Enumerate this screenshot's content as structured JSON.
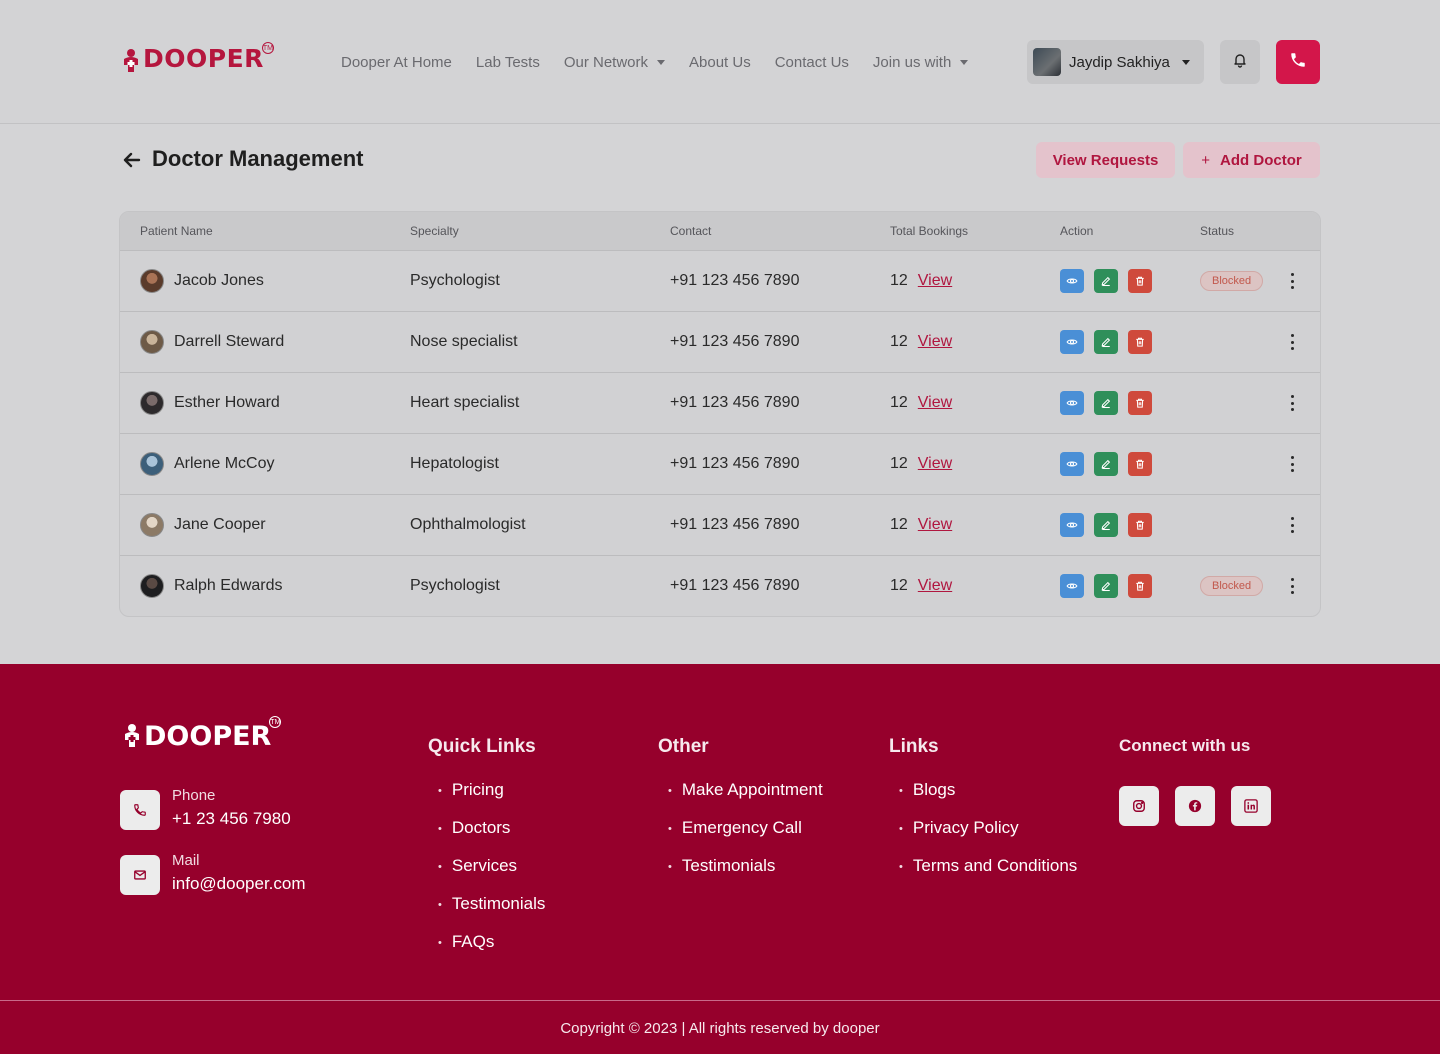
{
  "brand": {
    "name": "DOOPER",
    "tm": "TM",
    "color": "#b5163e"
  },
  "nav": {
    "items": [
      {
        "label": "Dooper At Home",
        "dropdown": false
      },
      {
        "label": "Lab Tests",
        "dropdown": false
      },
      {
        "label": "Our Network",
        "dropdown": true
      },
      {
        "label": "About Us",
        "dropdown": false
      },
      {
        "label": "Contact Us",
        "dropdown": false
      },
      {
        "label": "Join us with",
        "dropdown": true
      }
    ],
    "user_name": "Jaydip Sakhiya",
    "bell_icon": "bell-icon",
    "call_icon": "phone-icon"
  },
  "page": {
    "title": "Doctor Management",
    "view_requests": "View Requests",
    "add_doctor": "Add Doctor",
    "add_doctor_icon": "+"
  },
  "table": {
    "headers": [
      "Patient Name",
      "Specialty",
      "Contact",
      "Total Bookings",
      "Action",
      "Status"
    ],
    "rows": [
      {
        "name": "Jacob Jones",
        "specialty": "Psychologist",
        "contact": "+91 123 456 7890",
        "bookings": "12",
        "view": "View",
        "status": "Blocked"
      },
      {
        "name": "Darrell Steward",
        "specialty": "Nose specialist",
        "contact": "+91 123 456 7890",
        "bookings": "12",
        "view": "View",
        "status": ""
      },
      {
        "name": "Esther Howard",
        "specialty": "Heart specialist",
        "contact": "+91 123 456 7890",
        "bookings": "12",
        "view": "View",
        "status": ""
      },
      {
        "name": "Arlene McCoy",
        "specialty": "Hepatologist",
        "contact": "+91 123 456 7890",
        "bookings": "12",
        "view": "View",
        "status": ""
      },
      {
        "name": "Jane Cooper",
        "specialty": "Ophthalmologist",
        "contact": "+91 123 456 7890",
        "bookings": "12",
        "view": "View",
        "status": ""
      },
      {
        "name": "Ralph Edwards",
        "specialty": "Psychologist",
        "contact": "+91 123 456 7890",
        "bookings": "12",
        "view": "View",
        "status": "Blocked"
      }
    ]
  },
  "footer": {
    "phone_label": "Phone",
    "phone_value": "+1 23 456 7980",
    "mail_label": "Mail",
    "mail_value": "info@dooper.com",
    "quick_links": {
      "title": "Quick Links",
      "items": [
        "Pricing",
        "Doctors",
        "Services",
        "Testimonials",
        "FAQs"
      ]
    },
    "other": {
      "title": "Other",
      "items": [
        "Make Appointment",
        "Emergency Call",
        "Testimonials"
      ]
    },
    "links": {
      "title": "Links",
      "items": [
        "Blogs",
        "Privacy Policy",
        "Terms and Conditions"
      ]
    },
    "connect_title": "Connect with us",
    "social": [
      "instagram-icon",
      "facebook-icon",
      "linkedin-icon"
    ],
    "copyright": "Copyright © 2023 | All rights reserved by dooper",
    "bg_color": "#96002c"
  }
}
